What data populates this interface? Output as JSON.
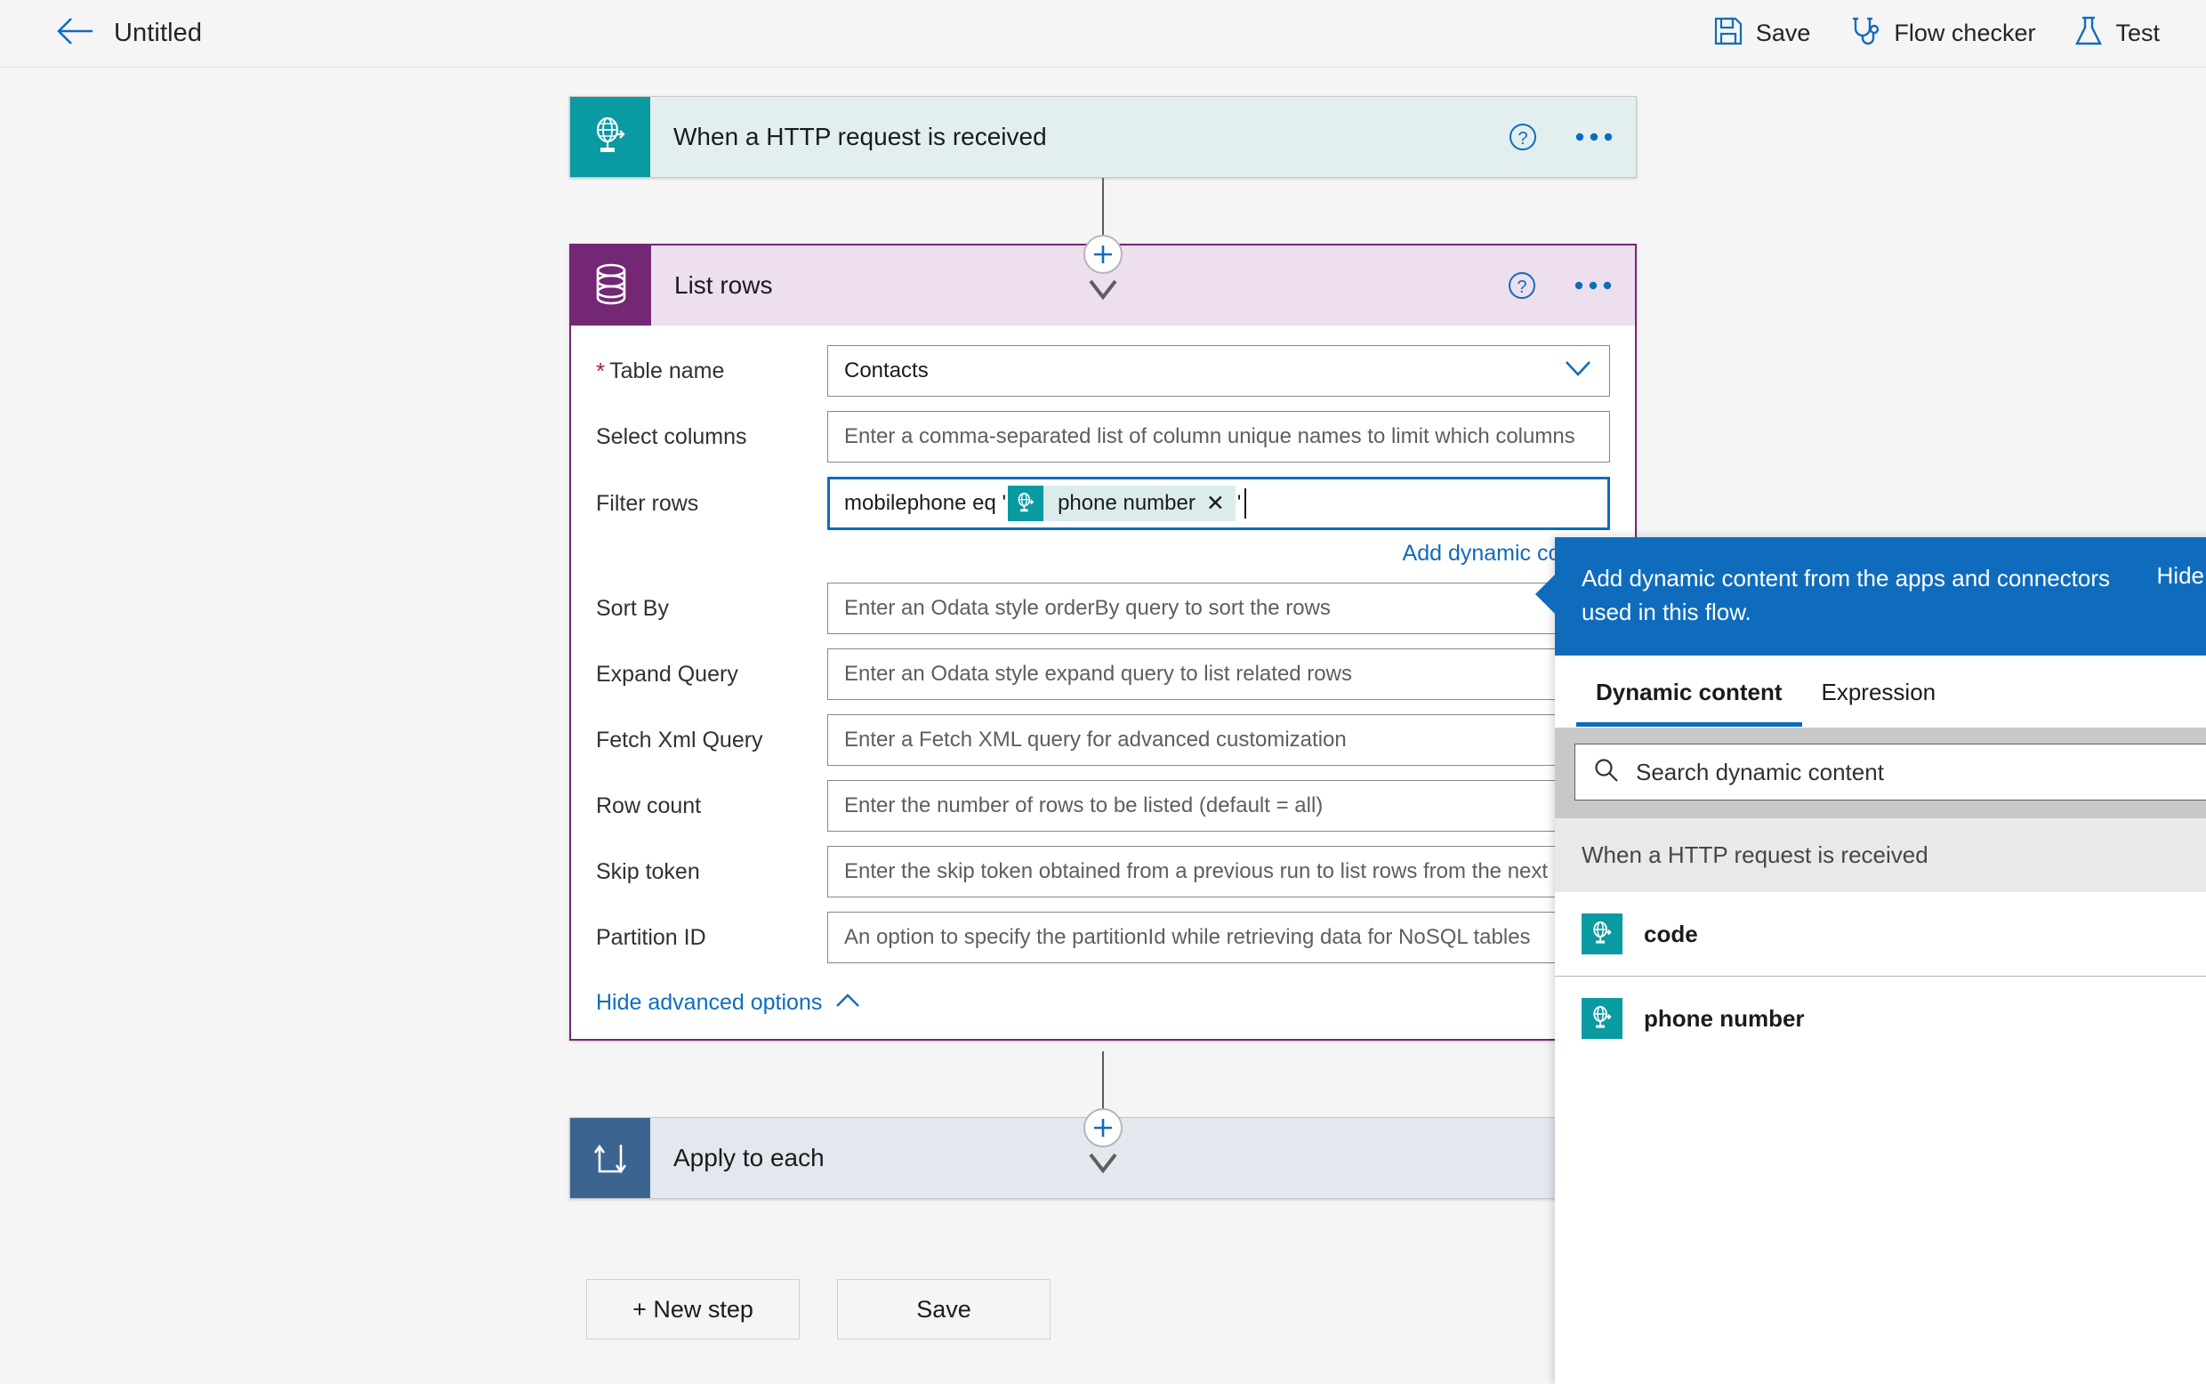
{
  "topbar": {
    "back_icon": "back-arrow-icon",
    "title": "Untitled",
    "actions": [
      {
        "label": "Save",
        "icon": "save-floppy-icon"
      },
      {
        "label": "Flow checker",
        "icon": "stethoscope-icon"
      },
      {
        "label": "Test",
        "icon": "flask-icon"
      }
    ]
  },
  "flow": {
    "trigger": {
      "title": "When a HTTP request is received",
      "icon": "http-request-icon",
      "icon_bg": "#0a9aa2",
      "header_bg": "#e3efef",
      "help_icon": "help-circle-icon",
      "more_icon": "ellipsis-icon"
    },
    "action": {
      "title": "List rows",
      "icon": "database-stack-icon",
      "icon_bg": "#742774",
      "header_bg": "#eddfed",
      "selected_border": "#742774",
      "help_icon": "help-circle-icon",
      "more_icon": "ellipsis-icon",
      "fields": [
        {
          "label": "Table name",
          "required": true,
          "value": "Contacts",
          "placeholder": "",
          "type": "dropdown",
          "chevron": "chevron-down-icon"
        },
        {
          "label": "Select columns",
          "required": false,
          "value": "",
          "placeholder": "Enter a comma-separated list of column unique names to limit which columns ",
          "type": "text"
        },
        {
          "label": "Filter rows",
          "required": false,
          "type": "token-field",
          "focused": true,
          "text_before": "mobilephone eq '",
          "token": {
            "label": "phone number",
            "icon": "http-request-icon",
            "remove_icon": "close-x-icon"
          },
          "text_after": "'"
        },
        {
          "label": "Sort By",
          "required": false,
          "value": "",
          "placeholder": "Enter an Odata style orderBy query to sort the rows",
          "type": "text"
        },
        {
          "label": "Expand Query",
          "required": false,
          "value": "",
          "placeholder": "Enter an Odata style expand query to list related rows",
          "type": "text"
        },
        {
          "label": "Fetch Xml Query",
          "required": false,
          "value": "",
          "placeholder": "Enter a Fetch XML query for advanced customization",
          "type": "text"
        },
        {
          "label": "Row count",
          "required": false,
          "value": "",
          "placeholder": "Enter the number of rows to be listed (default = all)",
          "type": "text"
        },
        {
          "label": "Skip token",
          "required": false,
          "value": "",
          "placeholder": "Enter the skip token obtained from a previous run to list rows from the next",
          "type": "text"
        },
        {
          "label": "Partition ID",
          "required": false,
          "value": "",
          "placeholder": "An option to specify the partitionId while retrieving data for NoSQL tables",
          "type": "text"
        }
      ],
      "add_dynamic_content_link": "Add dynamic content",
      "advanced_toggle": {
        "label": "Hide advanced options",
        "icon": "chevron-up-icon"
      }
    },
    "next_action": {
      "title": "Apply to each",
      "icon": "loop-icon",
      "icon_bg": "#3b6491",
      "header_bg": "#e3e7ee"
    },
    "connector_add_icon": "plus-icon"
  },
  "bottom_actions": [
    {
      "label": "+ New step"
    },
    {
      "label": "Save"
    }
  ],
  "dynamic_panel": {
    "banner_text": "Add dynamic content from the apps and connectors used in this flow.",
    "hide_label": "Hide",
    "banner_bg": "#0f6cbd",
    "tabs": [
      {
        "label": "Dynamic content",
        "active": true
      },
      {
        "label": "Expression",
        "active": false
      }
    ],
    "search": {
      "placeholder": "Search dynamic content",
      "icon": "search-icon"
    },
    "group_header": "When a HTTP request is received",
    "items": [
      {
        "label": "code",
        "icon": "http-request-icon"
      },
      {
        "label": "phone number",
        "icon": "http-request-icon"
      }
    ]
  }
}
